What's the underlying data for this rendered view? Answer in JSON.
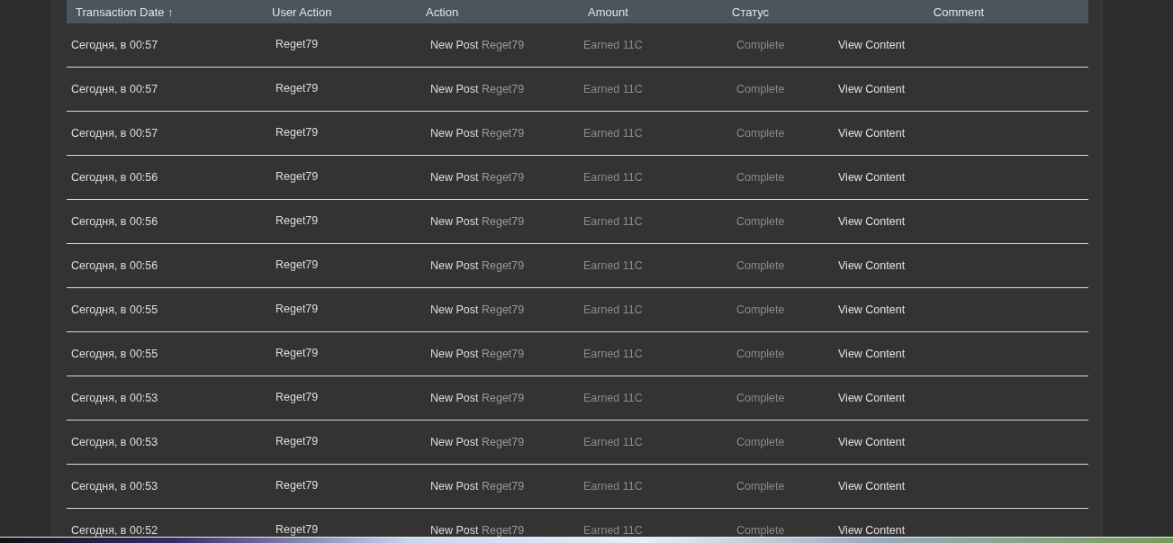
{
  "table": {
    "columns": [
      "Transaction Date ↑",
      "User Action",
      "Action",
      "Amount",
      "Статус",
      "Comment"
    ],
    "rows": [
      {
        "date": "Сегодня, в 00:57",
        "user": "Reget79",
        "action": "New Post",
        "action_user": "Reget79",
        "amount": "Earned 11C",
        "status": "Complete",
        "comment": "View Content"
      },
      {
        "date": "Сегодня, в 00:57",
        "user": "Reget79",
        "action": "New Post",
        "action_user": "Reget79",
        "amount": "Earned 11C",
        "status": "Complete",
        "comment": "View Content"
      },
      {
        "date": "Сегодня, в 00:57",
        "user": "Reget79",
        "action": "New Post",
        "action_user": "Reget79",
        "amount": "Earned 11C",
        "status": "Complete",
        "comment": "View Content"
      },
      {
        "date": "Сегодня, в 00:56",
        "user": "Reget79",
        "action": "New Post",
        "action_user": "Reget79",
        "amount": "Earned 11C",
        "status": "Complete",
        "comment": "View Content"
      },
      {
        "date": "Сегодня, в 00:56",
        "user": "Reget79",
        "action": "New Post",
        "action_user": "Reget79",
        "amount": "Earned 11C",
        "status": "Complete",
        "comment": "View Content"
      },
      {
        "date": "Сегодня, в 00:56",
        "user": "Reget79",
        "action": "New Post",
        "action_user": "Reget79",
        "amount": "Earned 11C",
        "status": "Complete",
        "comment": "View Content"
      },
      {
        "date": "Сегодня, в 00:55",
        "user": "Reget79",
        "action": "New Post",
        "action_user": "Reget79",
        "amount": "Earned 11C",
        "status": "Complete",
        "comment": "View Content"
      },
      {
        "date": "Сегодня, в 00:55",
        "user": "Reget79",
        "action": "New Post",
        "action_user": "Reget79",
        "amount": "Earned 11C",
        "status": "Complete",
        "comment": "View Content"
      },
      {
        "date": "Сегодня, в 00:53",
        "user": "Reget79",
        "action": "New Post",
        "action_user": "Reget79",
        "amount": "Earned 11C",
        "status": "Complete",
        "comment": "View Content"
      },
      {
        "date": "Сегодня, в 00:53",
        "user": "Reget79",
        "action": "New Post",
        "action_user": "Reget79",
        "amount": "Earned 11C",
        "status": "Complete",
        "comment": "View Content"
      },
      {
        "date": "Сегодня, в 00:53",
        "user": "Reget79",
        "action": "New Post",
        "action_user": "Reget79",
        "amount": "Earned 11C",
        "status": "Complete",
        "comment": "View Content"
      },
      {
        "date": "Сегодня, в 00:52",
        "user": "Reget79",
        "action": "New Post",
        "action_user": "Reget79",
        "amount": "Earned 11C",
        "status": "Complete",
        "comment": "View Content"
      }
    ]
  }
}
